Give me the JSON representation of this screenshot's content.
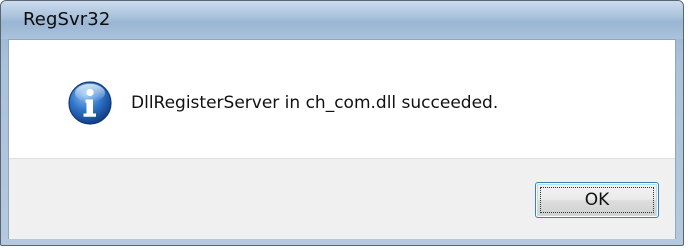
{
  "window": {
    "title": "RegSvr32"
  },
  "dialog": {
    "icon": "info-icon",
    "message": "DllRegisterServer in ch_com.dll succeeded.",
    "ok_label": "OK"
  },
  "colors": {
    "titlebar": "#a7c0da",
    "icon_blue": "#1f5fb3",
    "button_focus_border": "#3c7fb1"
  }
}
